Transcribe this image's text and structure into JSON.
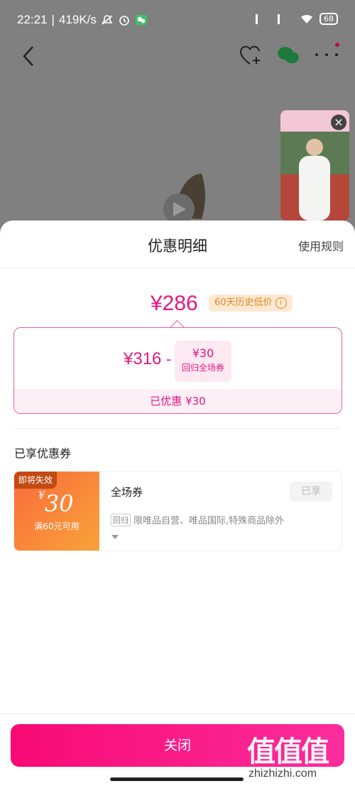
{
  "status_bar": {
    "time": "22:21",
    "speed": "419K/s",
    "battery": "68"
  },
  "sheet": {
    "title": "优惠明细",
    "rules_link": "使用规则",
    "final_price": "¥286",
    "low_price_badge": "60天历史低价",
    "original_price": "¥316",
    "minus": "-",
    "coupon_chip_amount": "¥30",
    "coupon_chip_label": "回归全场券",
    "saved_text": "已优惠 ¥30",
    "section_title": "已享优惠券",
    "coupon": {
      "expiring_tag": "即将失效",
      "currency": "¥",
      "amount": "30",
      "condition": "满60元可用",
      "name": "全场券",
      "status_button": "已享",
      "scope_tag": "回归",
      "scope_text": "限唯品自营、唯品国际,特殊商品除外"
    },
    "close_button": "关闭",
    "watermark": "值值值",
    "watermark_url": "zhizhizhi.com"
  },
  "colors": {
    "accent": "#e6187d",
    "coupon_gradient_start": "#f96b3a",
    "coupon_gradient_end": "#f9a33a"
  }
}
